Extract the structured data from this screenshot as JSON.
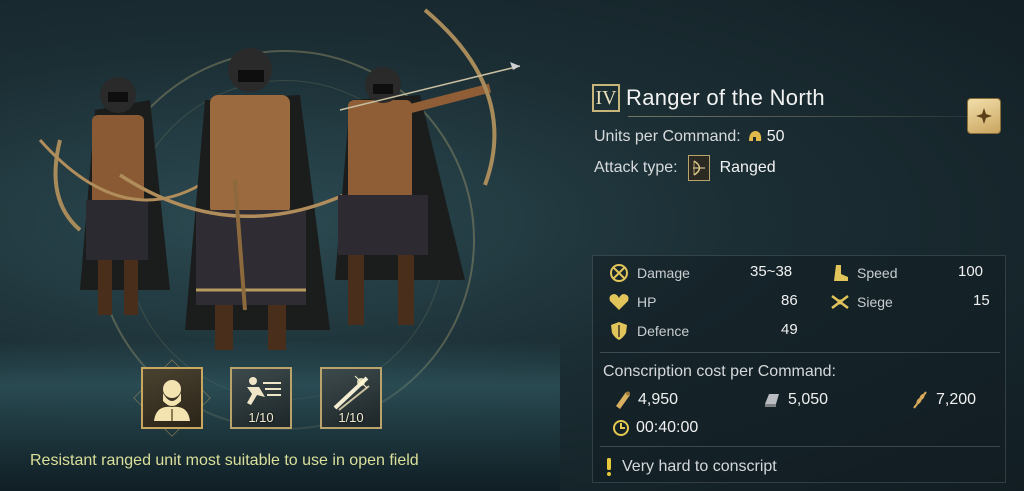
{
  "unit": {
    "tier": "IV",
    "name": "Ranger of the North",
    "units_per_command_label": "Units per Command:",
    "units_per_command": "50",
    "attack_type_label": "Attack type:",
    "attack_type": "Ranged",
    "description": "Resistant ranged unit most suitable to use in open field"
  },
  "skills": [
    {
      "name": "portrait-skill",
      "level": ""
    },
    {
      "name": "sprint-skill",
      "level": "1/10"
    },
    {
      "name": "blades-skill",
      "level": "1/10"
    }
  ],
  "stats": {
    "damage_label": "Damage",
    "damage": "35~38",
    "speed_label": "Speed",
    "speed": "100",
    "hp_label": "HP",
    "hp": "86",
    "siege_label": "Siege",
    "siege": "15",
    "defence_label": "Defence",
    "defence": "49"
  },
  "conscription": {
    "title": "Conscription cost per Command:",
    "wood": "4,950",
    "iron": "5,050",
    "grain": "7,200",
    "time": "00:40:00",
    "warning": "Very hard to conscript"
  },
  "colors": {
    "accent_gold": "#c8b57a",
    "description_yellow": "#dcdf9a",
    "warning_yellow": "#e6c93a"
  }
}
